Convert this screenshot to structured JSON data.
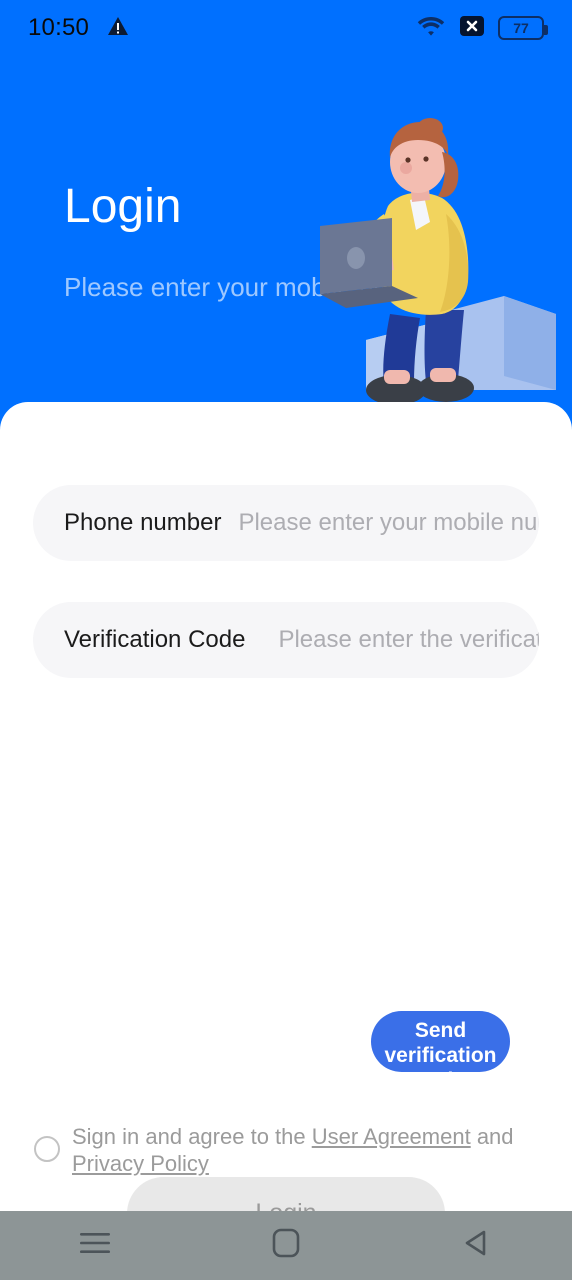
{
  "status_bar": {
    "time": "10:50",
    "warning_icon": "warning-triangle-icon",
    "wifi_icon": "wifi-icon",
    "no_sim_icon": "no-sim-x-icon",
    "battery_level": "77"
  },
  "header": {
    "title": "Login",
    "subtitle": "Please enter your mobile number",
    "background_color": "#0070ff",
    "illustration": "person-with-laptop-illustration"
  },
  "form": {
    "phone": {
      "label": "Phone number",
      "placeholder": "Please enter your mobile number"
    },
    "code": {
      "label": "Verification Code",
      "placeholder": "Please enter the verification code",
      "send_button": "Send verification code",
      "send_button_color": "#3a6fe8"
    },
    "login_button": "Login",
    "login_button_color": "#e8e8e8"
  },
  "agreement": {
    "checked": false,
    "prefix": "Sign in and agree to the ",
    "user_agreement": "User Agreement",
    "conjunction": " and ",
    "privacy_policy": "Privacy Policy"
  },
  "nav_bar": {
    "recents": "recent-apps-icon",
    "home": "home-icon",
    "back": "back-icon",
    "background_color": "#8d9596"
  }
}
